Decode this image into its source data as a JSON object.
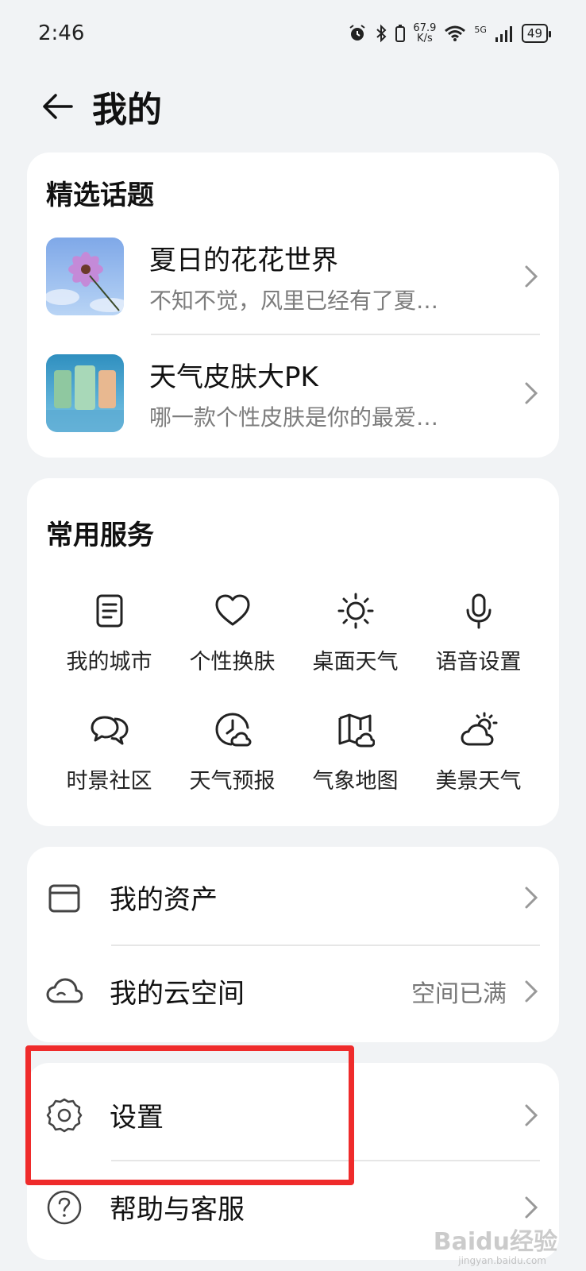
{
  "status_bar": {
    "time": "2:46",
    "speed_value": "67.9",
    "speed_unit": "K/s",
    "network": "5G",
    "battery": "49"
  },
  "header": {
    "title": "我的"
  },
  "featured": {
    "title": "精选话题",
    "items": [
      {
        "title": "夏日的花花世界",
        "subtitle": "不知不觉，风里已经有了夏…"
      },
      {
        "title": "天气皮肤大PK",
        "subtitle": "哪一款个性皮肤是你的最爱…"
      }
    ]
  },
  "services": {
    "title": "常用服务",
    "items": [
      {
        "label": "我的城市",
        "icon": "document-icon"
      },
      {
        "label": "个性换肤",
        "icon": "heart-icon"
      },
      {
        "label": "桌面天气",
        "icon": "sun-icon"
      },
      {
        "label": "语音设置",
        "icon": "microphone-icon"
      },
      {
        "label": "时景社区",
        "icon": "chat-bubbles-icon"
      },
      {
        "label": "天气预报",
        "icon": "clock-cloud-icon"
      },
      {
        "label": "气象地图",
        "icon": "map-icon"
      },
      {
        "label": "美景天气",
        "icon": "sun-cloud-icon"
      }
    ]
  },
  "assets": {
    "items": [
      {
        "label": "我的资产",
        "value": ""
      },
      {
        "label": "我的云空间",
        "value": "空间已满"
      }
    ]
  },
  "settings": {
    "items": [
      {
        "label": "设置"
      },
      {
        "label": "帮助与客服"
      }
    ]
  },
  "watermark": {
    "text": "Baidu经验",
    "sub": "jingyan.baidu.com"
  },
  "colors": {
    "highlight": "#ef2b2b",
    "background": "#f1f3f5",
    "card": "#ffffff"
  }
}
